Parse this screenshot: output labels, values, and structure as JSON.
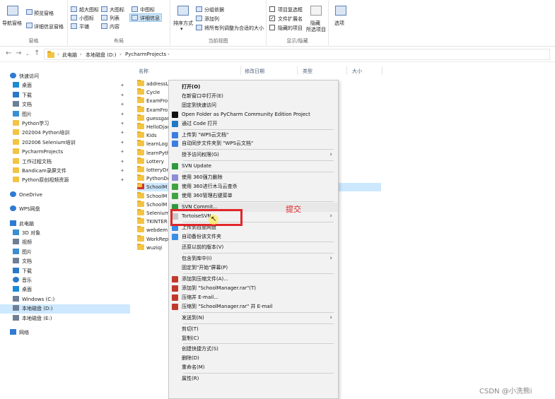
{
  "ribbon": {
    "nav_pane": "导航窗格",
    "preview_pane": "预览窗格",
    "details_pane": "详细信息窗格",
    "group_panes": "窗格",
    "layout": {
      "extra_large": "超大图标",
      "large": "大图标",
      "medium": "中图标",
      "small": "小图标",
      "list": "列表",
      "details": "详细信息",
      "tiles": "平铺",
      "content": "内容",
      "group_label": "布局"
    },
    "sort_by": "排序方式",
    "group_by": "分组依据",
    "add_column": "添加列",
    "fit_columns": "将所有列调整为合适的大小",
    "current_view_label": "当前视图",
    "item_checkbox": "项目复选框",
    "file_ext": "文件扩展名",
    "hidden_items": "隐藏的项目",
    "hide": "隐藏",
    "hide_selected": "所选项目",
    "show_hide_label": "显示/隐藏",
    "options": "选项"
  },
  "address": {
    "crumbs": [
      "此电脑",
      "本地磁盘 (D:)",
      "PycharmProjects"
    ]
  },
  "navpane": {
    "items": [
      {
        "label": "快速访问",
        "icon": "star-icon",
        "color": "#2f7bd3",
        "pinned": false,
        "indent": 0
      },
      {
        "label": "桌面",
        "icon": "desktop-icon",
        "color": "#1e8ad6",
        "pinned": true,
        "indent": 1
      },
      {
        "label": "下载",
        "icon": "download-icon",
        "color": "#2a79c8",
        "pinned": true,
        "indent": 1
      },
      {
        "label": "文档",
        "icon": "document-icon",
        "color": "#6e7f95",
        "pinned": true,
        "indent": 1
      },
      {
        "label": "图片",
        "icon": "picture-icon",
        "color": "#3b8ed2",
        "pinned": true,
        "indent": 1
      },
      {
        "label": "Python学习",
        "icon": "folder-icon",
        "color": "#f3c343",
        "pinned": true,
        "indent": 1
      },
      {
        "label": "202004 Python培训",
        "icon": "folder-icon",
        "color": "#f3c343",
        "pinned": true,
        "indent": 1
      },
      {
        "label": "202006 Selenium培训",
        "icon": "folder-icon",
        "color": "#f3c343",
        "pinned": true,
        "indent": 1
      },
      {
        "label": "PycharmProjects",
        "icon": "folder-icon",
        "color": "#f3c343",
        "pinned": true,
        "indent": 1
      },
      {
        "label": "工作过程文档",
        "icon": "folder-icon",
        "color": "#f3c343",
        "pinned": true,
        "indent": 1
      },
      {
        "label": "Bandicam录屏文件",
        "icon": "folder-icon",
        "color": "#f3c343",
        "pinned": true,
        "indent": 1
      },
      {
        "label": "Python原创视频资源",
        "icon": "folder-icon",
        "color": "#f3c343",
        "pinned": true,
        "indent": 1
      },
      {
        "label": "OneDrive",
        "icon": "cloud-icon",
        "color": "#2f7bd3",
        "pinned": false,
        "indent": 0,
        "gap": true
      },
      {
        "label": "WPS网盘",
        "icon": "cloud-icon",
        "color": "#2f7bd3",
        "pinned": false,
        "indent": 0,
        "gap": true
      },
      {
        "label": "此电脑",
        "icon": "computer-icon",
        "color": "#2f7bd3",
        "pinned": false,
        "indent": 0,
        "gap": true
      },
      {
        "label": "3D 对象",
        "icon": "cube-icon",
        "color": "#3b8ed2",
        "pinned": false,
        "indent": 1
      },
      {
        "label": "视频",
        "icon": "video-icon",
        "color": "#6e7f95",
        "pinned": false,
        "indent": 1
      },
      {
        "label": "图片",
        "icon": "picture-icon",
        "color": "#3b8ed2",
        "pinned": false,
        "indent": 1
      },
      {
        "label": "文档",
        "icon": "document-icon",
        "color": "#6e7f95",
        "pinned": false,
        "indent": 1
      },
      {
        "label": "下载",
        "icon": "download-icon",
        "color": "#2a79c8",
        "pinned": false,
        "indent": 1
      },
      {
        "label": "音乐",
        "icon": "music-icon",
        "color": "#2a79c8",
        "pinned": false,
        "indent": 1
      },
      {
        "label": "桌面",
        "icon": "desktop-icon",
        "color": "#1e8ad6",
        "pinned": false,
        "indent": 1
      },
      {
        "label": "Windows (C:)",
        "icon": "drive-icon",
        "color": "#6e7f95",
        "pinned": false,
        "indent": 1
      },
      {
        "label": "本地磁盘 (D:)",
        "icon": "drive-icon",
        "color": "#6e7f95",
        "pinned": false,
        "indent": 1,
        "selected": true
      },
      {
        "label": "本地磁盘 (E:)",
        "icon": "drive-icon",
        "color": "#6e7f95",
        "pinned": false,
        "indent": 1
      },
      {
        "label": "网络",
        "icon": "network-icon",
        "color": "#2f7bd3",
        "pinned": false,
        "indent": 0,
        "gap": true
      }
    ]
  },
  "filelist": {
    "columns": [
      "名称",
      "修改日期",
      "类型",
      "大小"
    ],
    "rows": [
      {
        "name": "addressL",
        "kind": "folder"
      },
      {
        "name": "Cycle",
        "kind": "folder"
      },
      {
        "name": "ExamFro",
        "kind": "folder"
      },
      {
        "name": "ExamFro",
        "kind": "folder"
      },
      {
        "name": "guessgar",
        "kind": "folder"
      },
      {
        "name": "HelloDjac",
        "kind": "folder"
      },
      {
        "name": "Kids",
        "kind": "folder"
      },
      {
        "name": "learnLog",
        "kind": "folder"
      },
      {
        "name": "learnPyth",
        "kind": "folder"
      },
      {
        "name": "Lottery",
        "kind": "folder"
      },
      {
        "name": "lotteryDr",
        "kind": "folder"
      },
      {
        "name": "PythonDe",
        "kind": "folder"
      },
      {
        "name": "SchoolM",
        "kind": "svn",
        "selected": true
      },
      {
        "name": "SchoolM",
        "kind": "folder"
      },
      {
        "name": "SchoolM",
        "kind": "folder"
      },
      {
        "name": "Selenium",
        "kind": "folder"
      },
      {
        "name": "TKINTER",
        "kind": "folder"
      },
      {
        "name": "webdem",
        "kind": "folder"
      },
      {
        "name": "WorkRep",
        "kind": "folder"
      },
      {
        "name": "wuziqi",
        "kind": "folder"
      }
    ]
  },
  "menu": {
    "items": [
      {
        "label": "打开(O)",
        "bold": true
      },
      {
        "label": "在新窗口中打开(E)"
      },
      {
        "label": "固定到快速访问"
      },
      {
        "label": "Open Folder as PyCharm Community Edition Project",
        "icon": "pycharm-icon",
        "color": "#111111"
      },
      {
        "label": "通过 Code 打开",
        "icon": "vscode-icon",
        "color": "#1f78c8"
      },
      {
        "sep": true
      },
      {
        "label": "上传到 \"WPS云文档\"",
        "icon": "wps-cloud-icon",
        "color": "#3c7ee0"
      },
      {
        "label": "自动同步文件夹到 \"WPS云文档\"",
        "icon": "wps-sync-icon",
        "color": "#3c7ee0"
      },
      {
        "sep": true
      },
      {
        "label": "授予访问权限(G)",
        "arrow": true
      },
      {
        "sep": true
      },
      {
        "label": "SVN Update",
        "icon": "svn-update-icon",
        "color": "#2d9a3e"
      },
      {
        "sep": true
      },
      {
        "label": "使用 360强力删除",
        "icon": "360-delete-icon",
        "color": "#8c8cd9"
      },
      {
        "label": "使用 360进行木马云查杀",
        "icon": "360-scan-icon",
        "color": "#3fa442"
      },
      {
        "label": "使用 360管理右键菜单",
        "icon": "360-menu-icon",
        "color": "#3fa442"
      },
      {
        "sep": true
      },
      {
        "label": "SVN Commit...",
        "icon": "svn-commit-icon",
        "color": "#2d9a3e",
        "hover": true
      },
      {
        "label": "TortoiseSVN",
        "arrow": true,
        "icon": "tortoise-icon",
        "color": "#c8c8c8"
      },
      {
        "sep": true
      },
      {
        "label": "上传到百度网盘",
        "icon": "baidu-icon",
        "color": "#3a8ee6"
      },
      {
        "label": "自动备份该文件夹",
        "icon": "backup-icon",
        "color": "#3a8ee6"
      },
      {
        "sep": true
      },
      {
        "label": "还原以前的版本(V)"
      },
      {
        "sep": true
      },
      {
        "label": "包含到库中(I)",
        "arrow": true
      },
      {
        "label": "固定到\"开始\"屏幕(P)"
      },
      {
        "sep": true
      },
      {
        "label": "添加到压缩文件(A)...",
        "icon": "winrar-icon",
        "color": "#c0392b"
      },
      {
        "label": "添加到 \"SchoolManager.rar\"(T)",
        "icon": "winrar-icon",
        "color": "#c0392b"
      },
      {
        "label": "压缩并 E-mail...",
        "icon": "winrar-icon",
        "color": "#c0392b"
      },
      {
        "label": "压缩到 \"SchoolManager.rar\" 并 E-mail",
        "icon": "winrar-icon",
        "color": "#c0392b"
      },
      {
        "sep": true
      },
      {
        "label": "发送到(N)",
        "arrow": true
      },
      {
        "sep": true
      },
      {
        "label": "剪切(T)"
      },
      {
        "label": "复制(C)"
      },
      {
        "sep": true
      },
      {
        "label": "创建快捷方式(S)"
      },
      {
        "label": "删除(D)"
      },
      {
        "label": "重命名(M)"
      },
      {
        "sep": true
      },
      {
        "label": "属性(R)"
      }
    ]
  },
  "annotation": "提交",
  "watermark": "CSDN @小洗熊i"
}
